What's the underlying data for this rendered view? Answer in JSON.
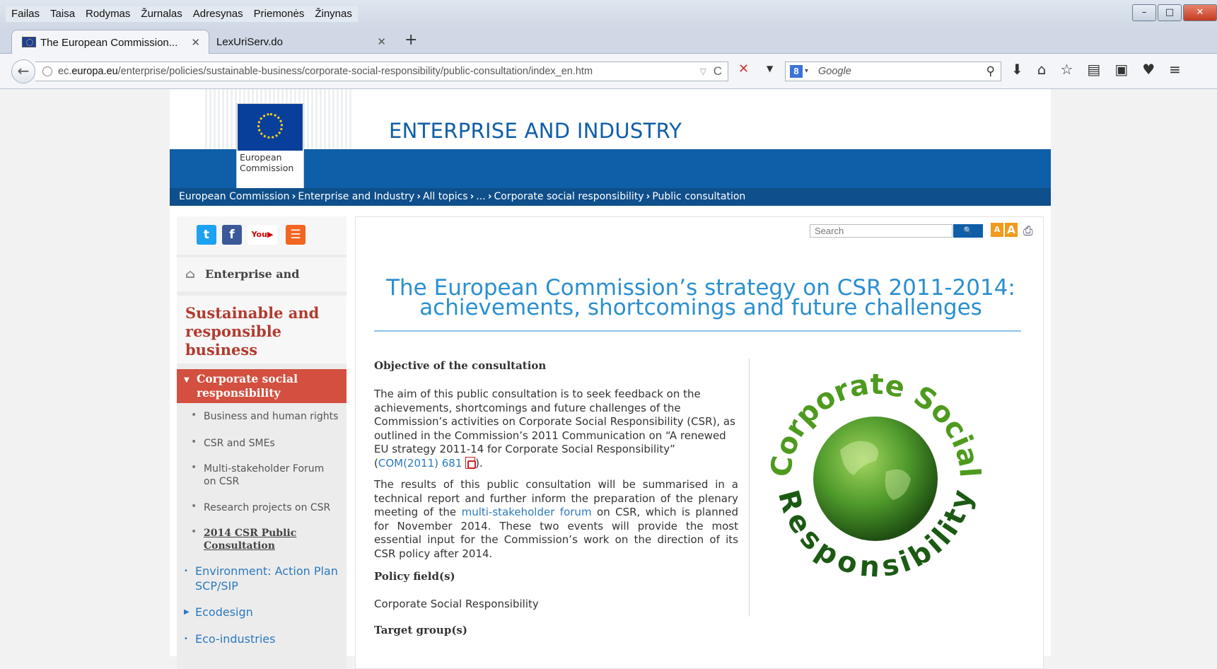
{
  "browser": {
    "menu": [
      "Failas",
      "Taisa",
      "Rodymas",
      "Žurnalas",
      "Adresynas",
      "Priemonės",
      "Žinynas"
    ],
    "tabs": [
      {
        "label": "The European Commission..."
      },
      {
        "label": "LexUriServ.do"
      }
    ],
    "url": {
      "prefix": "ec.",
      "domain": "europa.eu",
      "path": "/enterprise/policies/sustainable-business/corporate-social-responsibility/public-consultation/index_en.htm"
    },
    "search_placeholder": "Google"
  },
  "site": {
    "flag_label_line1": "European",
    "flag_label_line2": "Commission",
    "title": "ENTERPRISE AND INDUSTRY",
    "breadcrumb": [
      "European Commission",
      "Enterprise and Industry",
      "All topics",
      "...",
      "Corporate social responsibility",
      "Public consultation"
    ]
  },
  "sidebar": {
    "home_link": "Enterprise and Industry",
    "section_title_line1": "Sustainable and",
    "section_title_line2": "responsible",
    "section_title_line3": "business",
    "active_item_line1": "Corporate social",
    "active_item_line2": "responsibility",
    "sub_items": [
      {
        "line1": "Business and human rights"
      },
      {
        "line1": "CSR and SMEs"
      },
      {
        "line1": "Multi-stakeholder Forum",
        "line2": "on CSR"
      },
      {
        "line1": "Research projects on CSR"
      },
      {
        "line1": "2014 CSR Public",
        "line2": "Consultation"
      }
    ],
    "links": [
      {
        "line1": "Environment: Action Plan",
        "line2": "SCP/SIP"
      },
      {
        "line1": "Ecodesign"
      },
      {
        "line1": "Eco-industries"
      }
    ]
  },
  "main": {
    "search_placeholder": "Search",
    "title_line1": "The European Commission’s strategy on CSR 2011-2014:",
    "title_line2": "achievements, shortcomings and future challenges",
    "objective_heading": "Objective of the consultation",
    "para1_a": "The aim of this public consultation is to seek feedback on the achievements, shortcomings and future challenges of the Commission’s activities on Corporate Social Responsibility (CSR), as outlined in the Commission’s 2011 Communication on “A renewed EU strategy 2011-14 for Corporate Social Responsibility” (",
    "para1_link": "COM(2011) 681",
    "para1_b": ").",
    "para2_a": "The results of this public consultation will be summarised in a technical report and further inform the preparation of the plenary meeting of the ",
    "para2_link": "multi-stakeholder forum",
    "para2_b": " on CSR, which is planned for November 2014. These two events will provide the most essential input for the Commission’s work on the direction of its CSR policy after 2014.",
    "policy_heading": "Policy field(s)",
    "policy_value": "Corporate Social Responsibility",
    "target_heading": "Target group(s)",
    "logo_top": "Corporate Social",
    "logo_bottom": "Responsibility"
  }
}
